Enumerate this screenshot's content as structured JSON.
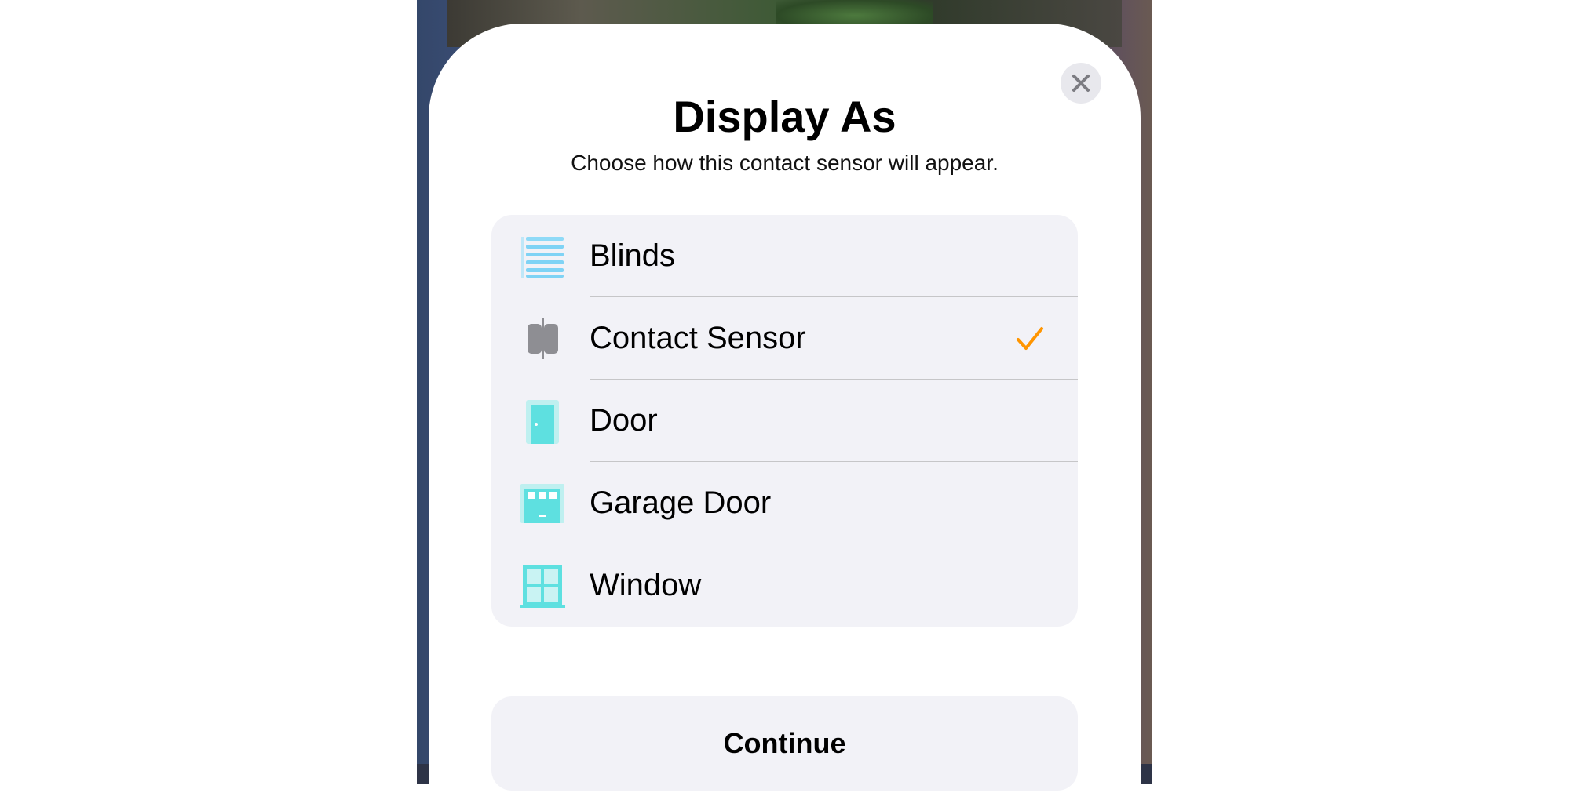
{
  "sheet": {
    "title": "Display As",
    "subtitle": "Choose how this contact sensor will appear.",
    "close_icon": "close-icon"
  },
  "options": [
    {
      "label": "Blinds",
      "icon": "blinds-icon",
      "selected": false
    },
    {
      "label": "Contact Sensor",
      "icon": "contact-sensor-icon",
      "selected": true
    },
    {
      "label": "Door",
      "icon": "door-icon",
      "selected": false
    },
    {
      "label": "Garage Door",
      "icon": "garage-door-icon",
      "selected": false
    },
    {
      "label": "Window",
      "icon": "window-icon",
      "selected": false
    }
  ],
  "continue_label": "Continue",
  "colors": {
    "accent_check": "#ff9500",
    "icon_teal": "#5ee0e0",
    "icon_blue": "#7fd3f5",
    "icon_gray": "#8e8e93",
    "list_bg": "#f2f2f7"
  }
}
